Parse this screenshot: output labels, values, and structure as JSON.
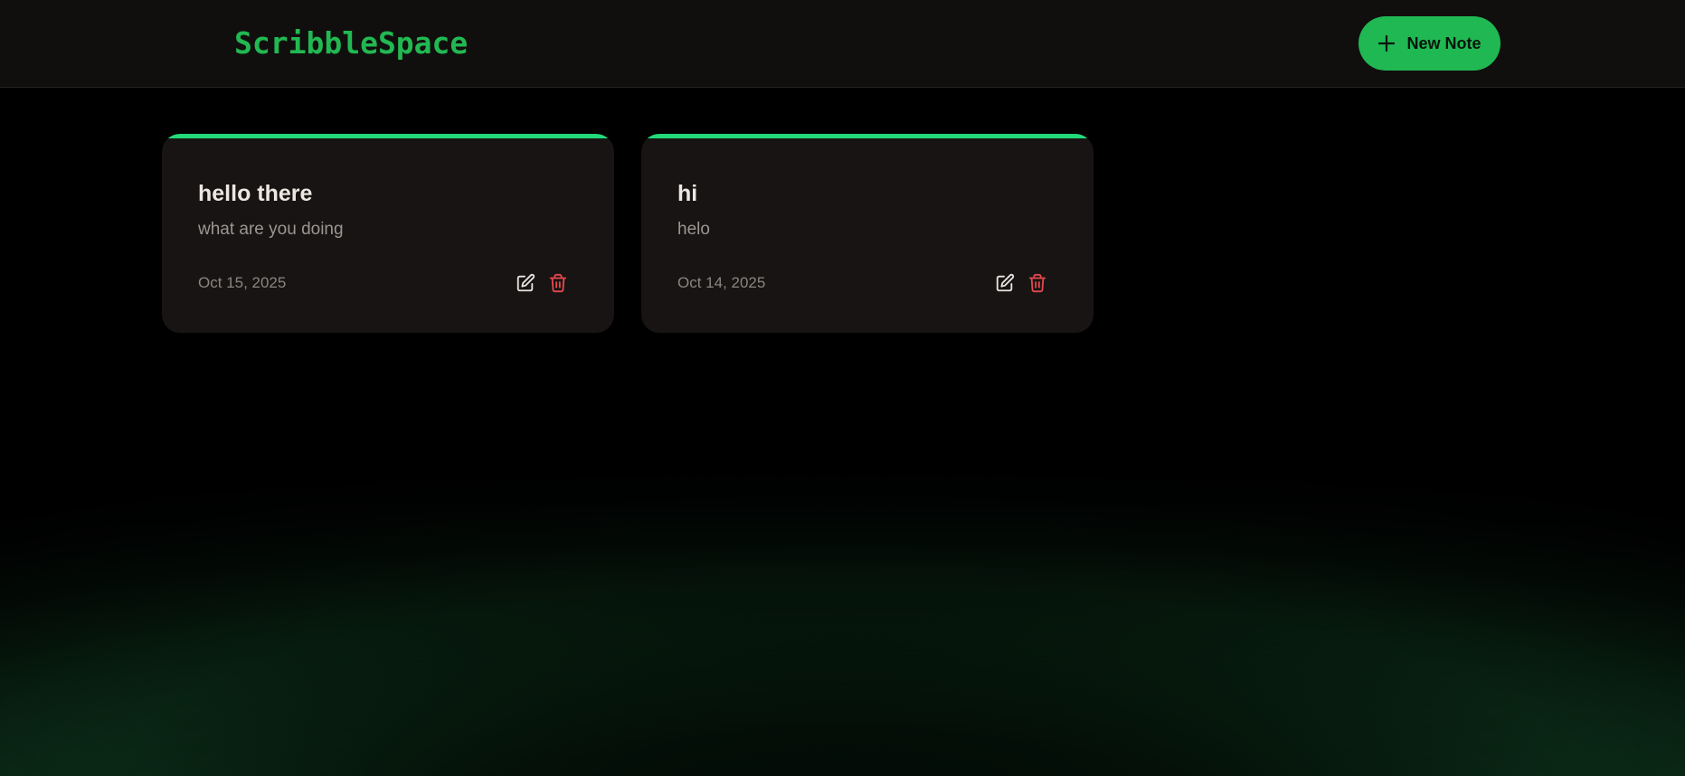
{
  "header": {
    "brand": "ScribbleSpace",
    "new_note_label": "New Note",
    "new_note_icon": "plus-icon"
  },
  "notes": [
    {
      "title": "hello there",
      "body": "what are you doing",
      "date": "Oct 15, 2025",
      "edit_icon": "edit-icon",
      "delete_icon": "trash-icon"
    },
    {
      "title": "hi",
      "body": "helo",
      "date": "Oct 14, 2025",
      "edit_icon": "edit-icon",
      "delete_icon": "trash-icon"
    }
  ],
  "colors": {
    "brand": "#22b852",
    "accent": "#1fb852",
    "card_top_border": "#22d97a",
    "delete": "#e5484d",
    "background": "#000000",
    "card_background": "#171413"
  }
}
